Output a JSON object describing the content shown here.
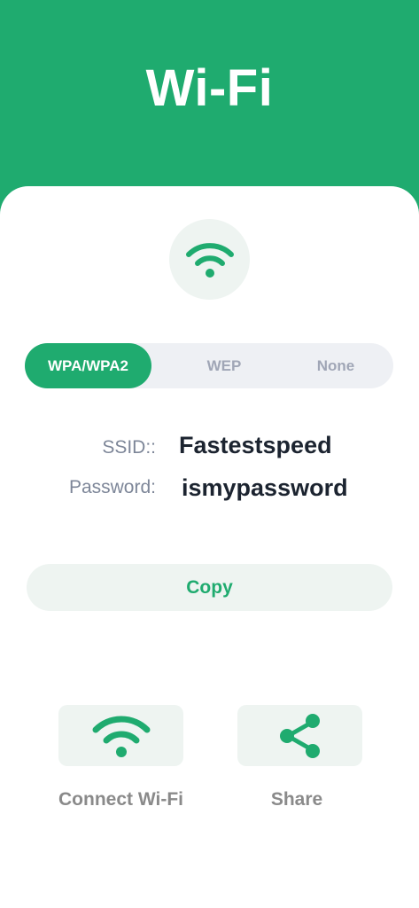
{
  "header": {
    "title": "Wi-Fi"
  },
  "security": {
    "options": [
      "WPA/WPA2",
      "WEP",
      "None"
    ],
    "selected": "WPA/WPA2"
  },
  "credentials": {
    "ssid_label": "SSID::",
    "ssid_value": "Fastestspeed",
    "password_label": "Password:",
    "password_value": "ismypassword"
  },
  "copy_label": "Copy",
  "actions": {
    "connect_label": "Connect Wi-Fi",
    "share_label": "Share"
  },
  "icons": {
    "badge": "wifi-icon",
    "connect": "wifi-icon",
    "share": "share-icon"
  },
  "colors": {
    "accent": "#1fab6f",
    "tile_bg": "#eef4f1",
    "segment_bg": "#eef0f4",
    "value_text": "#1c2430",
    "label_text": "#7d8698"
  }
}
